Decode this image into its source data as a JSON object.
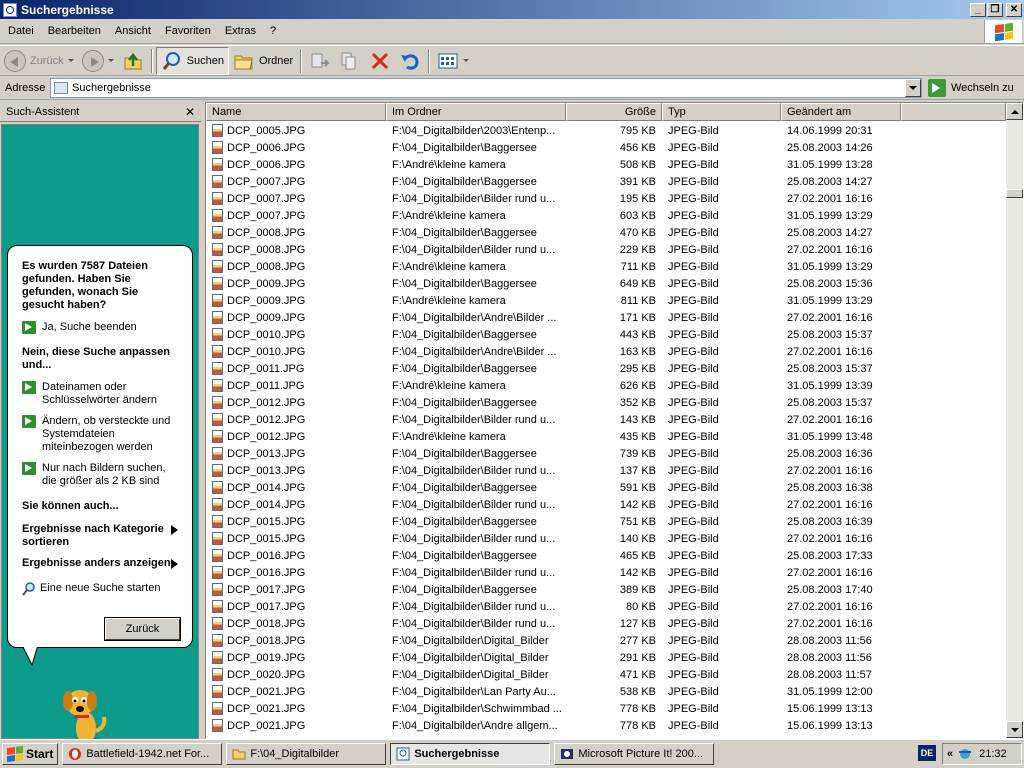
{
  "window": {
    "title": "Suchergebnisse"
  },
  "menu": [
    "Datei",
    "Bearbeiten",
    "Ansicht",
    "Favoriten",
    "Extras",
    "?"
  ],
  "toolbar": {
    "back_label": "Zurück",
    "search_label": "Suchen",
    "folders_label": "Ordner"
  },
  "address": {
    "label": "Adresse",
    "value": "Suchergebnisse",
    "go_label": "Wechseln zu"
  },
  "assistant": {
    "title": "Such-Assistent",
    "result_question": "Es wurden 7587 Dateien gefunden. Haben Sie gefunden, wonach Sie gesucht haben?",
    "yes_link": "Ja, Suche beenden",
    "refine_heading": "Nein, diese Suche anpassen und...",
    "refine_links": [
      "Dateinamen oder Schlüsselwörter ändern",
      "Ändern, ob versteckte und Systemdateien miteinbezogen werden",
      "Nur nach Bildern suchen, die größer als 2 KB sind"
    ],
    "also_heading": "Sie können auch...",
    "sort_menu": "Ergebnisse nach Kategorie sortieren",
    "view_menu": "Ergebnisse anders anzeigen",
    "new_search": "Eine neue Suche starten",
    "back_button": "Zurück"
  },
  "columns": {
    "name": "Name",
    "folder": "Im Ordner",
    "size": "Größe",
    "type": "Typ",
    "modified": "Geändert am"
  },
  "files": [
    {
      "name": "DCP_0005.JPG",
      "folder": "F:\\04_Digitalbilder\\2003\\Entenp...",
      "size": "795 KB",
      "type": "JPEG-Bild",
      "modified": "14.06.1999 20:31"
    },
    {
      "name": "DCP_0006.JPG",
      "folder": "F:\\04_Digitalbilder\\Baggersee",
      "size": "456 KB",
      "type": "JPEG-Bild",
      "modified": "25.08.2003 14:26"
    },
    {
      "name": "DCP_0006.JPG",
      "folder": "F:\\André\\kleine kamera",
      "size": "508 KB",
      "type": "JPEG-Bild",
      "modified": "31.05.1999 13:28"
    },
    {
      "name": "DCP_0007.JPG",
      "folder": "F:\\04_Digitalbilder\\Baggersee",
      "size": "391 KB",
      "type": "JPEG-Bild",
      "modified": "25.08.2003 14:27"
    },
    {
      "name": "DCP_0007.JPG",
      "folder": "F:\\04_Digitalbilder\\Bilder rund u...",
      "size": "195 KB",
      "type": "JPEG-Bild",
      "modified": "27.02.2001 16:16"
    },
    {
      "name": "DCP_0007.JPG",
      "folder": "F:\\André\\kleine kamera",
      "size": "603 KB",
      "type": "JPEG-Bild",
      "modified": "31.05.1999 13:29"
    },
    {
      "name": "DCP_0008.JPG",
      "folder": "F:\\04_Digitalbilder\\Baggersee",
      "size": "470 KB",
      "type": "JPEG-Bild",
      "modified": "25.08.2003 14:27"
    },
    {
      "name": "DCP_0008.JPG",
      "folder": "F:\\04_Digitalbilder\\Bilder rund u...",
      "size": "229 KB",
      "type": "JPEG-Bild",
      "modified": "27.02.2001 16:16"
    },
    {
      "name": "DCP_0008.JPG",
      "folder": "F:\\André\\kleine kamera",
      "size": "711 KB",
      "type": "JPEG-Bild",
      "modified": "31.05.1999 13:29"
    },
    {
      "name": "DCP_0009.JPG",
      "folder": "F:\\04_Digitalbilder\\Baggersee",
      "size": "649 KB",
      "type": "JPEG-Bild",
      "modified": "25.08.2003 15:36"
    },
    {
      "name": "DCP_0009.JPG",
      "folder": "F:\\André\\kleine kamera",
      "size": "811 KB",
      "type": "JPEG-Bild",
      "modified": "31.05.1999 13:29"
    },
    {
      "name": "DCP_0009.JPG",
      "folder": "F:\\04_Digitalbilder\\Andre\\Bilder ...",
      "size": "171 KB",
      "type": "JPEG-Bild",
      "modified": "27.02.2001 16:16"
    },
    {
      "name": "DCP_0010.JPG",
      "folder": "F:\\04_Digitalbilder\\Baggersee",
      "size": "443 KB",
      "type": "JPEG-Bild",
      "modified": "25.08.2003 15:37"
    },
    {
      "name": "DCP_0010.JPG",
      "folder": "F:\\04_Digitalbilder\\Andre\\Bilder ...",
      "size": "163 KB",
      "type": "JPEG-Bild",
      "modified": "27.02.2001 16:16"
    },
    {
      "name": "DCP_0011.JPG",
      "folder": "F:\\04_Digitalbilder\\Baggersee",
      "size": "295 KB",
      "type": "JPEG-Bild",
      "modified": "25.08.2003 15:37"
    },
    {
      "name": "DCP_0011.JPG",
      "folder": "F:\\André\\kleine kamera",
      "size": "626 KB",
      "type": "JPEG-Bild",
      "modified": "31.05.1999 13:39"
    },
    {
      "name": "DCP_0012.JPG",
      "folder": "F:\\04_Digitalbilder\\Baggersee",
      "size": "352 KB",
      "type": "JPEG-Bild",
      "modified": "25.08.2003 15:37"
    },
    {
      "name": "DCP_0012.JPG",
      "folder": "F:\\04_Digitalbilder\\Bilder rund u...",
      "size": "143 KB",
      "type": "JPEG-Bild",
      "modified": "27.02.2001 16:16"
    },
    {
      "name": "DCP_0012.JPG",
      "folder": "F:\\André\\kleine kamera",
      "size": "435 KB",
      "type": "JPEG-Bild",
      "modified": "31.05.1999 13:48"
    },
    {
      "name": "DCP_0013.JPG",
      "folder": "F:\\04_Digitalbilder\\Baggersee",
      "size": "739 KB",
      "type": "JPEG-Bild",
      "modified": "25.08.2003 16:36"
    },
    {
      "name": "DCP_0013.JPG",
      "folder": "F:\\04_Digitalbilder\\Bilder rund u...",
      "size": "137 KB",
      "type": "JPEG-Bild",
      "modified": "27.02.2001 16:16"
    },
    {
      "name": "DCP_0014.JPG",
      "folder": "F:\\04_Digitalbilder\\Baggersee",
      "size": "591 KB",
      "type": "JPEG-Bild",
      "modified": "25.08.2003 16:38"
    },
    {
      "name": "DCP_0014.JPG",
      "folder": "F:\\04_Digitalbilder\\Bilder rund u...",
      "size": "142 KB",
      "type": "JPEG-Bild",
      "modified": "27.02.2001 16:16"
    },
    {
      "name": "DCP_0015.JPG",
      "folder": "F:\\04_Digitalbilder\\Baggersee",
      "size": "751 KB",
      "type": "JPEG-Bild",
      "modified": "25.08.2003 16:39"
    },
    {
      "name": "DCP_0015.JPG",
      "folder": "F:\\04_Digitalbilder\\Bilder rund u...",
      "size": "140 KB",
      "type": "JPEG-Bild",
      "modified": "27.02.2001 16:16"
    },
    {
      "name": "DCP_0016.JPG",
      "folder": "F:\\04_Digitalbilder\\Baggersee",
      "size": "465 KB",
      "type": "JPEG-Bild",
      "modified": "25.08.2003 17:33"
    },
    {
      "name": "DCP_0016.JPG",
      "folder": "F:\\04_Digitalbilder\\Bilder rund u...",
      "size": "142 KB",
      "type": "JPEG-Bild",
      "modified": "27.02.2001 16:16"
    },
    {
      "name": "DCP_0017.JPG",
      "folder": "F:\\04_Digitalbilder\\Baggersee",
      "size": "389 KB",
      "type": "JPEG-Bild",
      "modified": "25.08.2003 17:40"
    },
    {
      "name": "DCP_0017.JPG",
      "folder": "F:\\04_Digitalbilder\\Bilder rund u...",
      "size": "80 KB",
      "type": "JPEG-Bild",
      "modified": "27.02.2001 16:16"
    },
    {
      "name": "DCP_0018.JPG",
      "folder": "F:\\04_Digitalbilder\\Bilder rund u...",
      "size": "127 KB",
      "type": "JPEG-Bild",
      "modified": "27.02.2001 16:16"
    },
    {
      "name": "DCP_0018.JPG",
      "folder": "F:\\04_Digitalbilder\\Digital_Bilder",
      "size": "277 KB",
      "type": "JPEG-Bild",
      "modified": "28.08.2003 11:56"
    },
    {
      "name": "DCP_0019.JPG",
      "folder": "F:\\04_Digitalbilder\\Digital_Bilder",
      "size": "291 KB",
      "type": "JPEG-Bild",
      "modified": "28.08.2003 11:56"
    },
    {
      "name": "DCP_0020.JPG",
      "folder": "F:\\04_Digitalbilder\\Digital_Bilder",
      "size": "471 KB",
      "type": "JPEG-Bild",
      "modified": "28.08.2003 11:57"
    },
    {
      "name": "DCP_0021.JPG",
      "folder": "F:\\04_Digitalbilder\\Lan Party Au...",
      "size": "538 KB",
      "type": "JPEG-Bild",
      "modified": "31.05.1999 12:00"
    },
    {
      "name": "DCP_0021.JPG",
      "folder": "F:\\04_Digitalbilder\\Schwimmbad ...",
      "size": "778 KB",
      "type": "JPEG-Bild",
      "modified": "15.06.1999 13:13"
    },
    {
      "name": "DCP_0021.JPG",
      "folder": "F:\\04_Digitalbilder\\Andre allgem...",
      "size": "778 KB",
      "type": "JPEG-Bild",
      "modified": "15.06.1999 13:13"
    }
  ],
  "taskbar": {
    "start_label": "Start",
    "tasks": [
      {
        "label": "Battlefield-1942.net For..."
      },
      {
        "label": "F:\\04_Digitalbilder"
      },
      {
        "label": "Suchergebnisse"
      },
      {
        "label": "Microsoft Picture It! 200..."
      }
    ],
    "language": "DE",
    "clock": "21:32"
  }
}
